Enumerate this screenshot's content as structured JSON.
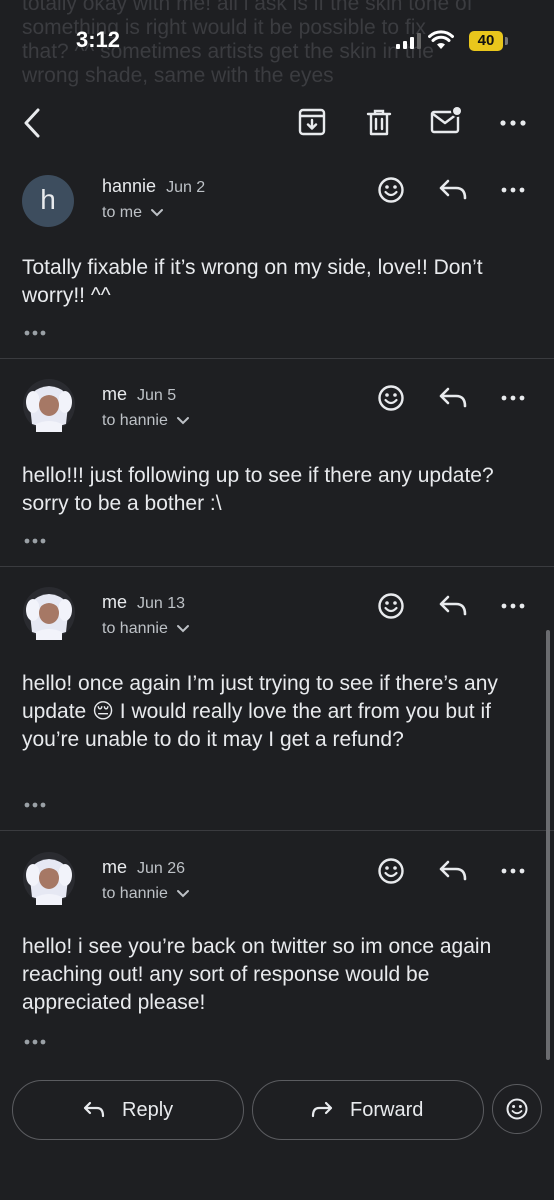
{
  "status_bar": {
    "time": "3:12",
    "battery": "40"
  },
  "background_text": "totally okay with me! all i ask is if the skin tone of\nsomething is right would it be possible to fix\nthat? ^^ sometimes artists get the skin in the\nwrong shade, same with the eyes",
  "toolbar": {
    "icons": [
      "back-arrow-icon",
      "archive-icon",
      "trash-icon",
      "mark-unread-icon",
      "more-icon"
    ]
  },
  "messages": [
    {
      "sender": "hannie",
      "avatar_letter": "h",
      "date": "Jun 2",
      "to": "to me",
      "body": "Totally fixable if it’s wrong on my side, love!! Don’t worry!! ^^"
    },
    {
      "sender": "me",
      "date": "Jun 5",
      "to": "to hannie",
      "body": "hello!!! just following up to see if there any update? sorry to be a bother :\\"
    },
    {
      "sender": "me",
      "date": "Jun 13",
      "to": "to hannie",
      "body": "hello! once again I’m just trying to see if there’s any update 😔 I would really love the art from you but if you’re unable to do it may I get a refund?"
    },
    {
      "sender": "me",
      "date": "Jun 26",
      "to": "to hannie",
      "body": "hello! i see you’re back on twitter so im once again reaching out! any sort of response would be appreciated please!"
    }
  ],
  "bottom_bar": {
    "reply_label": "Reply",
    "forward_label": "Forward"
  },
  "colors": {
    "background": "#1e1f22",
    "text": "#e8eaed",
    "battery": "#e9c61c",
    "divider": "#3a3b3f"
  }
}
